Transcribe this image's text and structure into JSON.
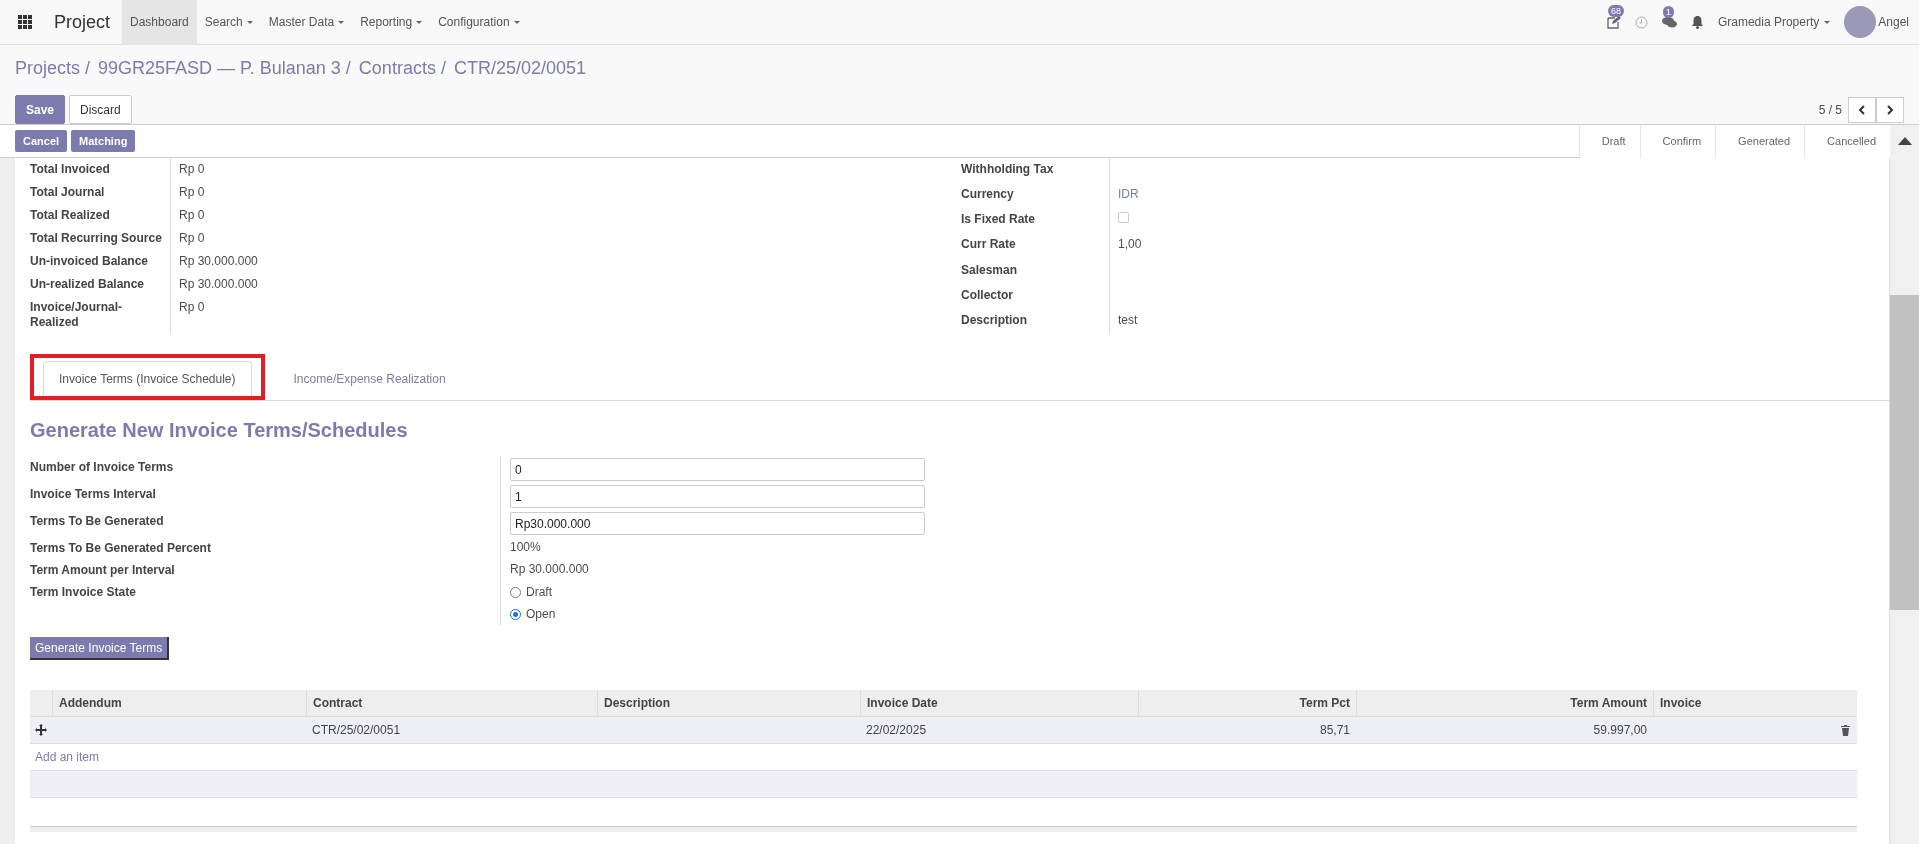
{
  "nav": {
    "app_title": "Project",
    "menu": [
      {
        "label": "Dashboard",
        "selected": true,
        "dropdown": false
      },
      {
        "label": "Search",
        "selected": false,
        "dropdown": true
      },
      {
        "label": "Master Data",
        "selected": false,
        "dropdown": true
      },
      {
        "label": "Reporting",
        "selected": false,
        "dropdown": true
      },
      {
        "label": "Configuration",
        "selected": false,
        "dropdown": true
      }
    ],
    "activity_badge": "68",
    "message_badge": "1",
    "company": "Gramedia Property",
    "user": "Angel"
  },
  "breadcrumb": [
    "Projects /",
    "99GR25FASD — P. Bulanan 3 /",
    "Contracts /",
    "CTR/25/02/0051"
  ],
  "buttons": [
    {
      "label": "Save",
      "kind": "primary"
    },
    {
      "label": "Discard",
      "kind": "secondary"
    }
  ],
  "pager": "5 / 5",
  "header_buttons": [
    "Cancel",
    "Matching"
  ],
  "stages": [
    "Draft",
    "Confirm",
    "Generated",
    "Cancelled"
  ],
  "summary_left": [
    {
      "label": "Total Invoiced",
      "value": "Rp 0"
    },
    {
      "label": "Total Journal",
      "value": "Rp 0"
    },
    {
      "label": "Total Realized",
      "value": "Rp 0"
    },
    {
      "label": "Total Recurring Source",
      "value": "Rp 0"
    },
    {
      "label": "Un-invoiced Balance",
      "value": "Rp 30.000.000"
    },
    {
      "label": "Un-realized Balance",
      "value": "Rp 30.000.000"
    },
    {
      "label": "Invoice/Journal-Realized",
      "value": "Rp 0"
    }
  ],
  "summary_right": [
    {
      "label": "Withholding Tax",
      "kind": "text"
    },
    {
      "label": "Currency",
      "kind": "link",
      "value": "IDR"
    },
    {
      "label": "Is Fixed Rate",
      "kind": "checkbox",
      "checked": false
    },
    {
      "label": "Curr Rate",
      "kind": "text",
      "value": "1,00"
    },
    {
      "label": "Salesman",
      "kind": "text"
    },
    {
      "label": "Collector",
      "kind": "text"
    },
    {
      "label": "Description",
      "kind": "text",
      "value": "test"
    }
  ],
  "tabs": [
    {
      "label": "Invoice Terms (Invoice Schedule)",
      "selected": true,
      "highlighted": true
    },
    {
      "label": "Income/Expense Realization",
      "selected": false,
      "highlighted": false
    }
  ],
  "generate": {
    "title": "Generate New Invoice Terms/Schedules",
    "fields": [
      {
        "label": "Number of Invoice Terms",
        "kind": "input",
        "value": "0"
      },
      {
        "label": "Invoice Terms Interval",
        "kind": "input",
        "value": "1"
      },
      {
        "label": "Terms To Be Generated",
        "kind": "input",
        "value": "Rp30.000.000"
      },
      {
        "label": "Terms To Be Generated Percent",
        "kind": "text",
        "value": "100%"
      },
      {
        "label": "Term Amount per Interval",
        "kind": "text",
        "value": "Rp 30.000.000"
      },
      {
        "label": "Term Invoice State",
        "kind": "radio",
        "options": [
          {
            "label": "Draft",
            "selected": false
          },
          {
            "label": "Open",
            "selected": true
          }
        ]
      }
    ],
    "button": "Generate Invoice Terms"
  },
  "table": {
    "columns": [
      {
        "label": "Addendum",
        "kind": "text"
      },
      {
        "label": "Contract",
        "kind": "text"
      },
      {
        "label": "Description",
        "kind": "text"
      },
      {
        "label": "Invoice Date",
        "kind": "text"
      },
      {
        "label": "Term Pct",
        "kind": "number"
      },
      {
        "label": "Term Amount",
        "kind": "number"
      },
      {
        "label": "Invoice",
        "kind": "text"
      }
    ],
    "rows": [
      {
        "cells": [
          "",
          "CTR/25/02/0051",
          "",
          "22/02/2025",
          "85,71",
          "59.997,00",
          ""
        ]
      }
    ],
    "add_item": "Add an item"
  }
}
